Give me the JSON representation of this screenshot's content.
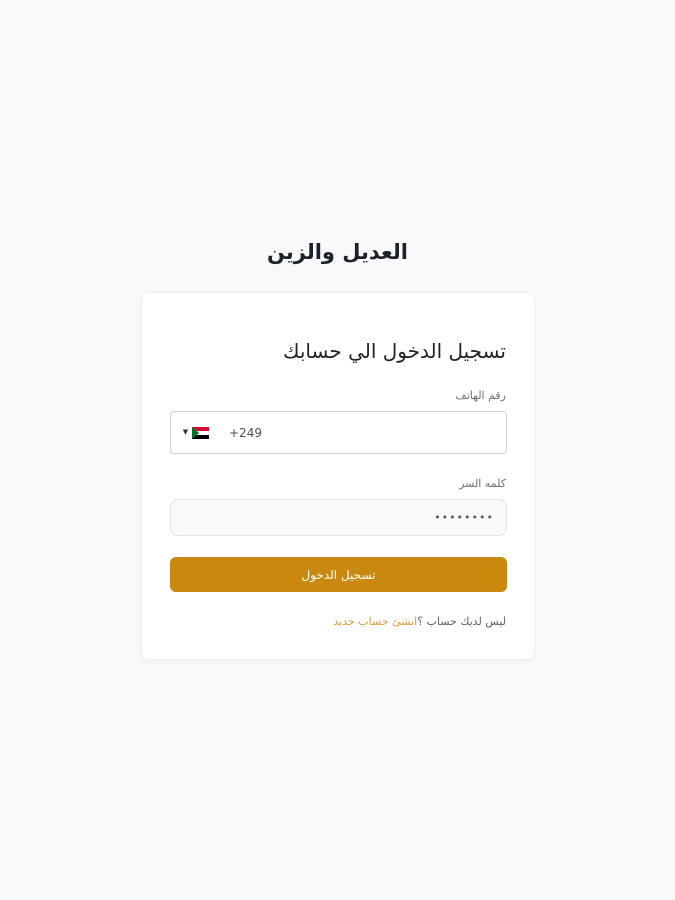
{
  "brand": {
    "name": "العديل والزين"
  },
  "login": {
    "title": "تسجيل الدخول الي حسابك",
    "phone_label": "رقم الهاتف",
    "phone_value": "+249",
    "password_label": "كلمه السر",
    "password_value": "••••••••",
    "submit_label": "تسجيل الدخول",
    "no_account_text": "ليس لديك حساب ؟",
    "create_account_link": "انشئ حساب جديد"
  },
  "country": {
    "flag": "sudan-flag-icon",
    "caret": "▼"
  },
  "colors": {
    "accent": "#c8890e",
    "link": "#d99a3c",
    "background": "#f8f9fb",
    "card": "#ffffff"
  }
}
